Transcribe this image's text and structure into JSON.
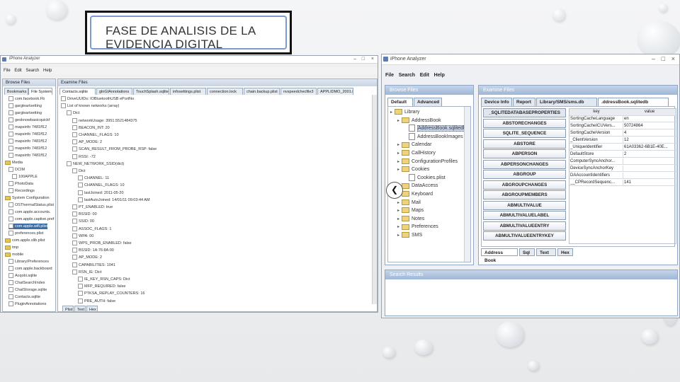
{
  "slide": {
    "title_line1": "FASE DE ANALISIS  DE LA",
    "title_line2": "EVIDENCIA DIGITAL"
  },
  "left_window": {
    "title": "iPhone Analyzer",
    "menu": [
      "File",
      "Edit",
      "Search",
      "Help"
    ],
    "browse_header": "Browse Files",
    "browse_tabs": [
      "Bookmarks",
      "File System"
    ],
    "examine_header": "Examine Files",
    "examine_tabs": [
      "Contacts.sqlite",
      "glnGIAnnotations",
      "TouchSplash.sqlite3",
      "infosettings.plist",
      "connection.lock",
      "chain.backup.plist",
      "nvspeedchecfile3",
      "APPLIDMO_2001.MOV"
    ],
    "tree_items": [
      "com.facebook.Fb",
      "gargleartsetting",
      "gargleartsetting",
      "geoknowbasicquickf",
      "mapsinfo 7481ff12",
      "mapsinfo 7481ff12",
      "mapsinfo 7481ff12",
      "mapsinfo 7481ff12",
      "mapsinfo 7481ff12",
      "Media",
      "DCIM",
      "100APPLE",
      "PhotoData",
      "Recordings",
      "System Configuration",
      "OSThermalStatus.plist",
      "com.apple.accounts.",
      "com.apple.captive.pref",
      "com.apple.wifi.plist",
      "preferences.plist",
      "com.apple.xlib.plist",
      "tmp",
      "mobile",
      "Library/Preferences",
      "com.apple.backboard",
      "Acqobi.sqlite",
      "ChatSearchIndex",
      "ChatStorage.sqlite",
      "Contacts.sqlite",
      "PluginAnnotations"
    ],
    "detail_items": [
      "DriveUUIDs: IOBluetoothUSB ePortNo",
      "List of known networks (array)",
      "Dict",
      "networkUsage: 3951.5521484375",
      "BEACON_INT: 20",
      "CHANNEL_FLAGS: 10",
      "AP_MODE: 2",
      "SCAN_RESULT_FROM_PROBE_RSP: false",
      "RSSI: -72",
      "NEW_NETWORK_SSID(dict)",
      "Dict",
      "CHANNEL: 11",
      "CHANNEL_FLAGS: 10",
      "lastJoined: 2011-05-20",
      "lastAutoJoined: 14/01/11 09:03:44 AM",
      "PT_ENABLED: true",
      "BSSID: 00",
      "SSID: 00",
      "ASSOC_FLAGS: 1",
      "WPA: 00",
      "WPS_PROB_ENABLED: false",
      "BSSID: 1A:76:8A:00",
      "AP_MODE: 2",
      "CAPABILITIES: 1041",
      "RSN_IE: Dict",
      "IE_KEY_RSN_CAPS: Dict",
      "MFP_REQUIRED: false",
      "PTKSA_REPLAY_COUNTERS: 16",
      "PRE_AUTH: false"
    ],
    "bottom_tabs": [
      "Plist",
      "Text",
      "Hex"
    ]
  },
  "right_window": {
    "title": "iPhone Analyzer",
    "menu": [
      "File",
      "Search",
      "Edit",
      "Help"
    ],
    "browse_header": "Browse Files",
    "browse_tabs": [
      "Default",
      "Advanced"
    ],
    "examine_header": "Examine Files",
    "examine_tabs": [
      "Device Info",
      "Report",
      "Library/SMS/sms.db",
      ".ddressBook.sqlitedb"
    ],
    "tree": [
      {
        "label": "Library",
        "kind": "folder",
        "indent": 0
      },
      {
        "label": "AddressBook",
        "kind": "folder",
        "indent": 1
      },
      {
        "label": "AddressBook.sqlitedb",
        "kind": "file",
        "indent": 2,
        "selected": true
      },
      {
        "label": "AddressBookImages",
        "kind": "file",
        "indent": 2
      },
      {
        "label": "Calendar",
        "kind": "folder",
        "indent": 1
      },
      {
        "label": "CallHistory",
        "kind": "folder",
        "indent": 1
      },
      {
        "label": "ConfigurationProfiles",
        "kind": "folder",
        "indent": 1
      },
      {
        "label": "Cookies",
        "kind": "folder",
        "indent": 1
      },
      {
        "label": "Cookies.plist",
        "kind": "file",
        "indent": 2
      },
      {
        "label": "DataAccess",
        "kind": "folder",
        "indent": 1
      },
      {
        "label": "Keyboard",
        "kind": "folder",
        "indent": 1
      },
      {
        "label": "Mail",
        "kind": "folder",
        "indent": 1
      },
      {
        "label": "Maps",
        "kind": "folder",
        "indent": 1
      },
      {
        "label": "Notes",
        "kind": "folder",
        "indent": 1
      },
      {
        "label": "Preferences",
        "kind": "folder",
        "indent": 1
      },
      {
        "label": "SMS",
        "kind": "folder",
        "indent": 1
      }
    ],
    "tables": [
      "_SQLITEDATABASEPROPERTIES",
      "ABSTORECHANGES",
      "SQLITE_SEQUENCE",
      "ABSTORE",
      "ABPERSON",
      "ABPERSONCHANGES",
      "ABGROUP",
      "ABGROUPCHANGES",
      "ABGROUPMEMBERS",
      "ABMULTIVALUE",
      "ABMULTIVALUELABEL",
      "ABMULTIVALUEENTRY",
      "ABMULTIVALUEENTRYKEY"
    ],
    "grid_headers": [
      "key",
      "value"
    ],
    "grid_rows": [
      [
        "SortingCacheLanguage",
        "en"
      ],
      [
        "SortingCacheICUVers...",
        "50724864"
      ],
      [
        "SortingCacheVersion",
        "4"
      ],
      [
        "_ClientVersion",
        "12"
      ],
      [
        "_UniqueIdentifier",
        "61A03362-6B1E-40E..."
      ],
      [
        "DefaultStore",
        "2"
      ],
      [
        "ComputerSyncAnchor...",
        ""
      ],
      [
        "DeviceSyncAnchorKey",
        ""
      ],
      [
        "DAAccountIdentifiers",
        ""
      ],
      [
        "__CPRecordSequenc...",
        "141"
      ]
    ],
    "bottom_tabs": [
      "Address Book",
      "Sql",
      "Text",
      "Hex"
    ],
    "search_header": "Search Results"
  }
}
